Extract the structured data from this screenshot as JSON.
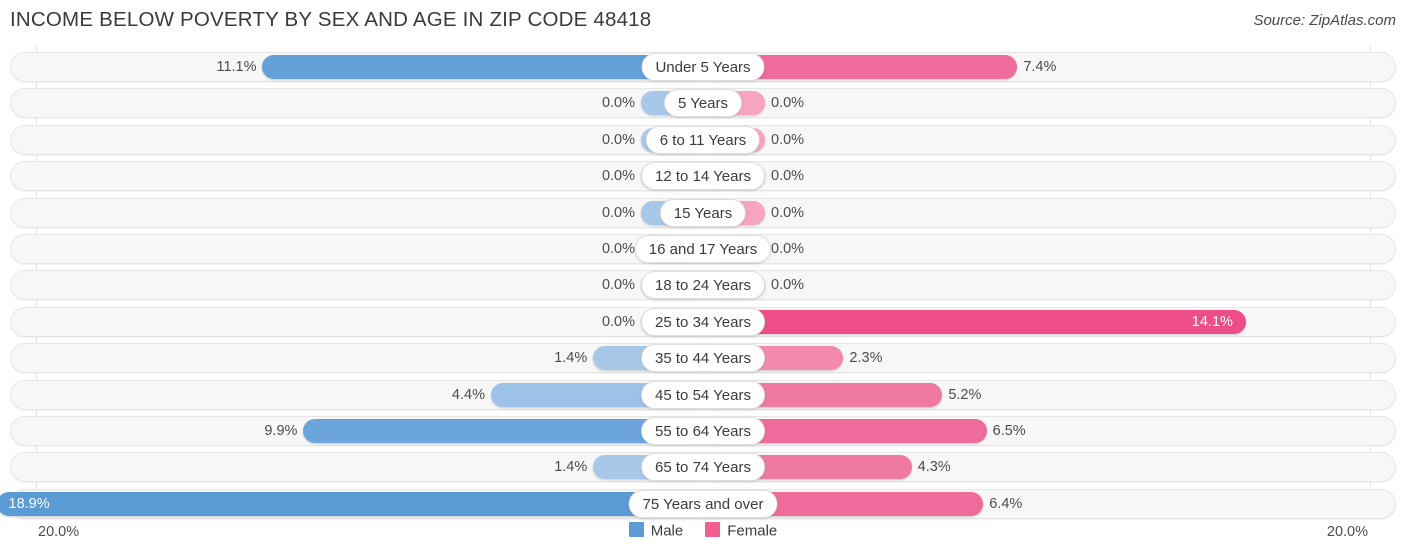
{
  "header": {
    "title": "INCOME BELOW POVERTY BY SEX AND AGE IN ZIP CODE 48418",
    "source": "Source: ZipAtlas.com"
  },
  "footer": {
    "left_axis_label": "20.0%",
    "right_axis_label": "20.0%",
    "legend": [
      {
        "label": "Male",
        "color": "#5b9bd5"
      },
      {
        "label": "Female",
        "color": "#ef5f92"
      }
    ]
  },
  "colors": {
    "male_strong": "#63a0d8",
    "male_light": "#a8c8ea",
    "female_strong": "#ee4e87",
    "female_mid": "#f07ba6",
    "female_light": "#f7a4c0",
    "row_fill": "#f7f7f7",
    "row_border": "#e6e6e6",
    "axis_line": "#e3e3e3",
    "text": "#4c4c4c"
  },
  "chart_data": {
    "type": "bar",
    "title": "INCOME BELOW POVERTY BY SEX AND AGE IN ZIP CODE 48418",
    "subtitle": "",
    "orientation": "horizontal-diverging",
    "xlabel": "",
    "ylabel": "",
    "xlim": [
      20.0,
      20.0
    ],
    "axis_left_max": 20.0,
    "axis_right_max": 20.0,
    "grid": false,
    "legend_position": "bottom-center",
    "categories": [
      "Under 5 Years",
      "5 Years",
      "6 to 11 Years",
      "12 to 14 Years",
      "15 Years",
      "16 and 17 Years",
      "18 to 24 Years",
      "25 to 34 Years",
      "35 to 44 Years",
      "45 to 54 Years",
      "55 to 64 Years",
      "65 to 74 Years",
      "75 Years and over"
    ],
    "series": [
      {
        "name": "Male",
        "values": [
          11.1,
          0.0,
          0.0,
          0.0,
          0.0,
          0.0,
          0.0,
          0.0,
          1.4,
          4.4,
          9.9,
          1.4,
          18.9
        ],
        "labels": [
          "11.1%",
          "0.0%",
          "0.0%",
          "0.0%",
          "0.0%",
          "0.0%",
          "0.0%",
          "0.0%",
          "1.4%",
          "4.4%",
          "9.9%",
          "1.4%",
          "18.9%"
        ]
      },
      {
        "name": "Female",
        "values": [
          7.4,
          0.0,
          0.0,
          0.0,
          0.0,
          0.0,
          0.0,
          14.1,
          2.3,
          5.2,
          6.5,
          4.3,
          6.4
        ],
        "labels": [
          "7.4%",
          "0.0%",
          "0.0%",
          "0.0%",
          "0.0%",
          "0.0%",
          "0.0%",
          "14.1%",
          "2.3%",
          "5.2%",
          "6.5%",
          "4.3%",
          "6.4%"
        ]
      }
    ]
  },
  "rows": [
    {
      "category": "Under 5 Years",
      "male": 11.1,
      "male_label": "11.1%",
      "male_color": "#63a0d8",
      "male_inside": false,
      "female": 7.4,
      "female_label": "7.4%",
      "female_color": "#ef6b9b",
      "female_inside": false
    },
    {
      "category": "5 Years",
      "male": 0.0,
      "male_label": "0.0%",
      "male_color": "#a8c8ea",
      "male_inside": false,
      "female": 0.0,
      "female_label": "0.0%",
      "female_color": "#f7a4c0",
      "female_inside": false
    },
    {
      "category": "6 to 11 Years",
      "male": 0.0,
      "male_label": "0.0%",
      "male_color": "#a8c8ea",
      "male_inside": false,
      "female": 0.0,
      "female_label": "0.0%",
      "female_color": "#f7a4c0",
      "female_inside": false
    },
    {
      "category": "12 to 14 Years",
      "male": 0.0,
      "male_label": "0.0%",
      "male_color": "#a8c8ea",
      "male_inside": false,
      "female": 0.0,
      "female_label": "0.0%",
      "female_color": "#f7a4c0",
      "female_inside": false
    },
    {
      "category": "15 Years",
      "male": 0.0,
      "male_label": "0.0%",
      "male_color": "#a8c8ea",
      "male_inside": false,
      "female": 0.0,
      "female_label": "0.0%",
      "female_color": "#f7a4c0",
      "female_inside": false
    },
    {
      "category": "16 and 17 Years",
      "male": 0.0,
      "male_label": "0.0%",
      "male_color": "#a8c8ea",
      "male_inside": false,
      "female": 0.0,
      "female_label": "0.0%",
      "female_color": "#f7a4c0",
      "female_inside": false
    },
    {
      "category": "18 to 24 Years",
      "male": 0.0,
      "male_label": "0.0%",
      "male_color": "#a8c8ea",
      "male_inside": false,
      "female": 0.0,
      "female_label": "0.0%",
      "female_color": "#f7a4c0",
      "female_inside": false
    },
    {
      "category": "25 to 34 Years",
      "male": 0.0,
      "male_label": "0.0%",
      "male_color": "#a8c8ea",
      "male_inside": false,
      "female": 14.1,
      "female_label": "14.1%",
      "female_color": "#ee4e87",
      "female_inside": true
    },
    {
      "category": "35 to 44 Years",
      "male": 1.4,
      "male_label": "1.4%",
      "male_color": "#a8c8ea",
      "male_inside": false,
      "female": 2.3,
      "female_label": "2.3%",
      "female_color": "#f289ae",
      "female_inside": false
    },
    {
      "category": "45 to 54 Years",
      "male": 4.4,
      "male_label": "4.4%",
      "male_color": "#9dc2e8",
      "male_inside": false,
      "female": 5.2,
      "female_label": "5.2%",
      "female_color": "#f0799f",
      "female_inside": false
    },
    {
      "category": "55 to 64 Years",
      "male": 9.9,
      "male_label": "9.9%",
      "male_color": "#6ba5da",
      "male_inside": false,
      "female": 6.5,
      "female_label": "6.5%",
      "female_color": "#ef6b9b",
      "female_inside": false
    },
    {
      "category": "65 to 74 Years",
      "male": 1.4,
      "male_label": "1.4%",
      "male_color": "#a8c8ea",
      "male_inside": false,
      "female": 4.3,
      "female_label": "4.3%",
      "female_color": "#f0799f",
      "female_inside": false
    },
    {
      "category": "75 Years and over",
      "male": 18.9,
      "male_label": "18.9%",
      "male_color": "#5b9bd5",
      "male_inside": true,
      "female": 6.4,
      "female_label": "6.4%",
      "female_color": "#ef6b9b",
      "female_inside": false
    }
  ]
}
